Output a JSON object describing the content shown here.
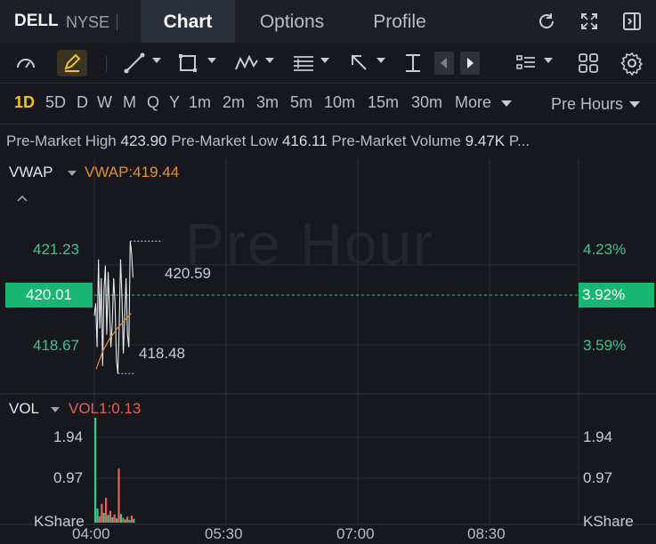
{
  "header": {
    "ticker": "DELL",
    "exchange": "NYSE",
    "separator": "|",
    "tabs": [
      "Chart",
      "Options",
      "Profile"
    ],
    "active_tab": "Chart"
  },
  "toolbar": {
    "icons": [
      "gauge-icon",
      "pencil-icon",
      "line-tool-icon",
      "rectangle-tool-icon",
      "pattern-tool-icon",
      "fibonacci-tool-icon",
      "arrow-tool-icon",
      "measure-tool-icon",
      "scroll-left-icon",
      "scroll-right-icon",
      "list-icon",
      "grid-icon",
      "settings-icon"
    ]
  },
  "periods": {
    "items": [
      "1D",
      "5D",
      "D",
      "W",
      "M",
      "Q",
      "Y",
      "1m",
      "2m",
      "3m",
      "5m",
      "10m",
      "15m",
      "30m"
    ],
    "active": "1D",
    "more_label": "More",
    "session_label": "Pre Hours"
  },
  "info": {
    "high_label": "Pre-Market High",
    "high_value": "423.90",
    "low_label": "Pre-Market Low",
    "low_value": "416.11",
    "volume_label": "Pre-Market Volume",
    "volume_value": "9.47K",
    "overflow": "P..."
  },
  "price_panel": {
    "indicator": "VWAP",
    "indicator_value": "VWAP:419.44",
    "watermark": "Pre Hour",
    "left_axis": [
      "421.23",
      "418.67"
    ],
    "right_axis": [
      "4.23%",
      "3.59%"
    ],
    "current_price": "420.01",
    "current_change": "3.92%",
    "high_marker": "420.59",
    "low_marker": "418.48"
  },
  "volume_panel": {
    "indicator": "VOL",
    "indicator_value": "VOL1:0.13",
    "left_axis": [
      "1.94",
      "0.97",
      "KShare"
    ],
    "right_axis": [
      "1.94",
      "0.97",
      "KShare"
    ]
  },
  "time_axis": [
    "04:00",
    "05:30",
    "07:00",
    "08:30"
  ],
  "colors": {
    "up": "#38c98a",
    "down": "#e2625a",
    "vwap": "#e6902c",
    "active_period": "#f0c419"
  },
  "chart_data": {
    "type": "line",
    "price_series": [
      419.4,
      419.6,
      418.9,
      420.3,
      419.2,
      420.0,
      418.6,
      419.8,
      420.2,
      419.1,
      420.1,
      419.5,
      418.9,
      419.3,
      420.0,
      419.6,
      418.7,
      418.48,
      419.2,
      420.3,
      419.7,
      418.8,
      419.4,
      420.0,
      419.1,
      418.9,
      420.59,
      420.4,
      420.01
    ],
    "vwap_series": [
      418.55,
      418.7,
      418.85,
      418.95,
      419.05,
      419.12,
      419.2,
      419.26,
      419.32,
      419.38,
      419.44
    ],
    "volume_bars": [
      {
        "v": 1.94,
        "up": true
      },
      {
        "v": 0.26,
        "up": true
      },
      {
        "v": 0.12,
        "up": false
      },
      {
        "v": 0.35,
        "up": false
      },
      {
        "v": 0.18,
        "up": true
      },
      {
        "v": 0.46,
        "up": false
      },
      {
        "v": 0.14,
        "up": true
      },
      {
        "v": 0.22,
        "up": false
      },
      {
        "v": 0.1,
        "up": true
      },
      {
        "v": 0.15,
        "up": false
      },
      {
        "v": 0.08,
        "up": true
      },
      {
        "v": 1.0,
        "up": false
      },
      {
        "v": 0.16,
        "up": true
      },
      {
        "v": 0.09,
        "up": false
      },
      {
        "v": 0.06,
        "up": true
      },
      {
        "v": 0.11,
        "up": false
      },
      {
        "v": 0.05,
        "up": true
      },
      {
        "v": 0.13,
        "up": false
      },
      {
        "v": 0.07,
        "up": true
      }
    ],
    "price_ylim": [
      418.2,
      421.6
    ],
    "volume_ylim": [
      0,
      1.94
    ]
  }
}
